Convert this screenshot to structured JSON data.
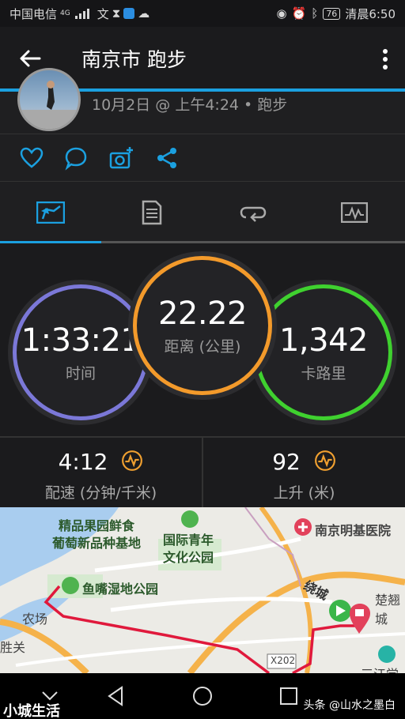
{
  "status_bar": {
    "carrier": "中国电信",
    "network": "4G",
    "battery": "76",
    "time": "清晨6:50"
  },
  "app_bar": {
    "title": "南京市 跑步"
  },
  "activity": {
    "subtitle": "10月2日 @ 上午4:24 • 跑步"
  },
  "stats": {
    "time": {
      "value": "1:33:21",
      "label": "时间",
      "color": "#7b78d8"
    },
    "distance": {
      "value": "22.22",
      "label": "距离 (公里)",
      "color": "#f39a2b"
    },
    "calories": {
      "value": "1,342",
      "label": "卡路里",
      "color": "#3fd12f"
    }
  },
  "metrics": {
    "pace": {
      "value": "4:12",
      "label": "配速 (分钟/千米)"
    },
    "ascent": {
      "value": "92",
      "label": "上升 (米)"
    }
  },
  "map": {
    "labels": {
      "park_1a": "精品果园鲜食",
      "park_1b": "葡萄新品种基地",
      "park_2a": "国际青年",
      "park_2b": "文化公园",
      "park_3": "鱼嘴湿地公园",
      "hospital": "南京明基医院",
      "road_1": "绕城",
      "place_1": "农场",
      "place_2": "胜关",
      "place_3": "楚翘城",
      "place_4": "三江学院",
      "road_code": "X202"
    },
    "colors": {
      "route": "#e0193c",
      "park": "#4fb34f",
      "hospital": "#e2415b"
    }
  },
  "watermark": {
    "left": "小城生活",
    "right": "头条 @山水之墨白"
  },
  "theme": {
    "accent": "#1ba0e0"
  }
}
